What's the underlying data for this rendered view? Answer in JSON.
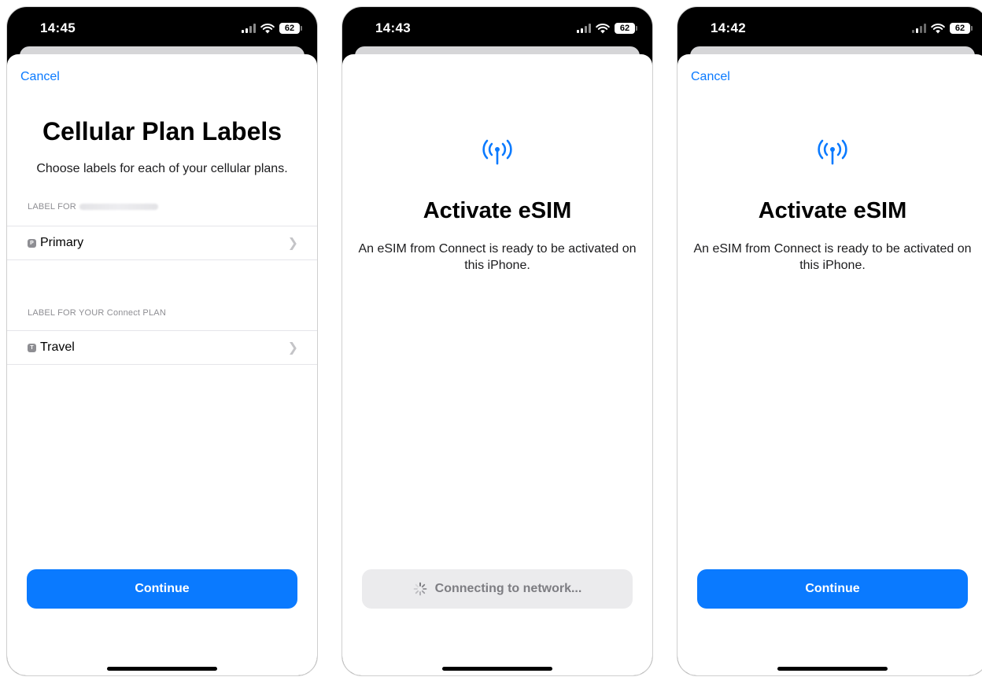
{
  "colors": {
    "accent": "#0a7aff",
    "disabled_bg": "#ebebed",
    "disabled_text": "#7d7d82",
    "secondary_text": "#8e8e93"
  },
  "screens": [
    {
      "status": {
        "time": "14:45",
        "battery": "62"
      },
      "cancel_label": "Cancel",
      "title": "Cellular Plan Labels",
      "subtitle": "Choose labels for each of your cellular plans.",
      "sections": [
        {
          "header": "LABEL FOR",
          "header_redacted": true,
          "badge": "P",
          "row_label": "Primary",
          "icon": "chevron-right-icon"
        },
        {
          "header": "LABEL FOR YOUR Connect PLAN",
          "badge": "T",
          "row_label": "Travel",
          "icon": "chevron-right-icon"
        }
      ],
      "button_label": "Continue"
    },
    {
      "status": {
        "time": "14:43",
        "battery": "62"
      },
      "icon": "cellular-antenna-icon",
      "title": "Activate eSIM",
      "subtitle": "An eSIM from Connect is ready to be activated on this iPhone.",
      "button_label": "Connecting to network...",
      "button_icon": "spinner-icon"
    },
    {
      "status": {
        "time": "14:42",
        "battery": "62"
      },
      "cancel_label": "Cancel",
      "icon": "cellular-antenna-icon",
      "title": "Activate eSIM",
      "subtitle": "An eSIM from Connect is ready to be activated on this iPhone.",
      "button_label": "Continue"
    }
  ]
}
